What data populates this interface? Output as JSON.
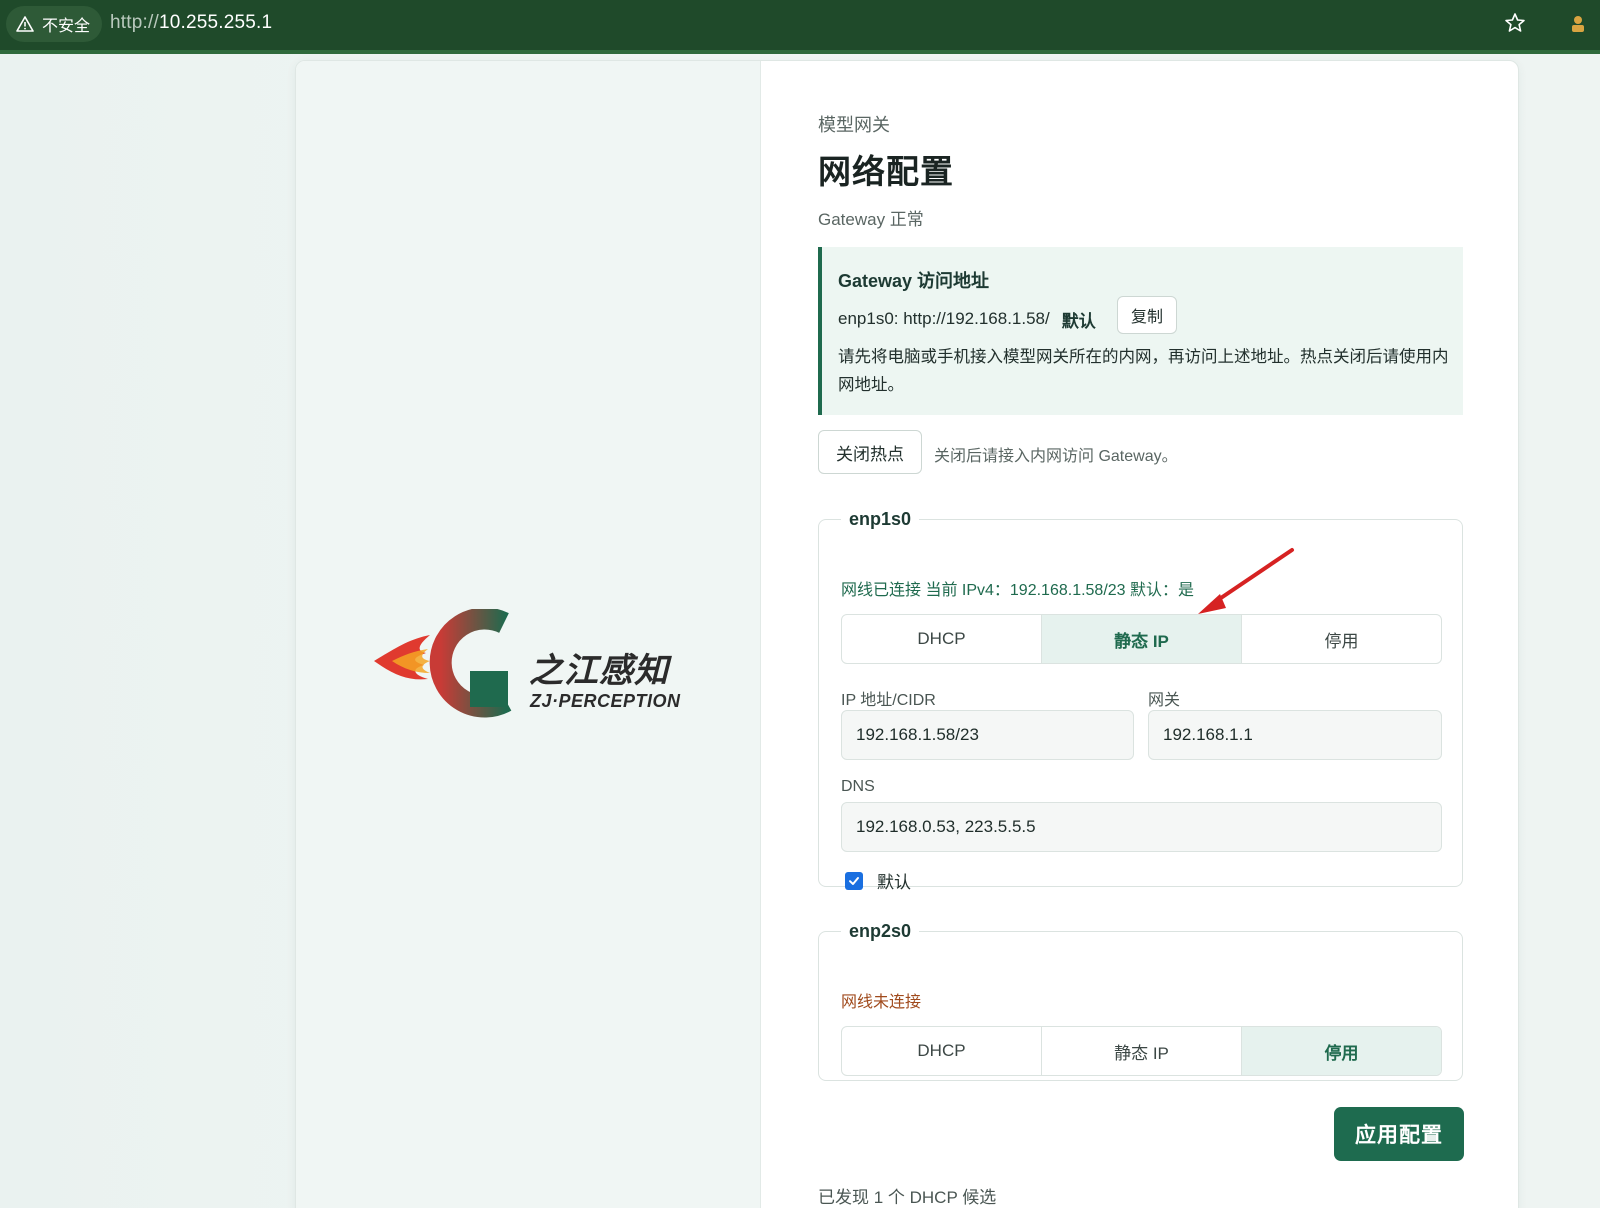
{
  "browser": {
    "security_label": "不安全",
    "url_scheme": "http://",
    "url_host": "10.255.255.1"
  },
  "brand": {
    "name_cn": "之江感知",
    "name_en": "ZJ·PERCEPTION"
  },
  "header": {
    "kicker": "模型网关",
    "title": "网络配置",
    "status": "Gateway 正常"
  },
  "access": {
    "title": "Gateway 访问地址",
    "address": "enp1s0: http://192.168.1.58/",
    "default_label": "默认",
    "copy_label": "复制",
    "note": "请先将电脑或手机接入模型网关所在的内网，再访问上述地址。热点关闭后请使用内网地址。"
  },
  "hotspot": {
    "button_label": "关闭热点",
    "note": "关闭后请接入内网访问 Gateway。"
  },
  "interfaces": [
    {
      "name": "enp1s0",
      "status": "网线已连接 当前 IPv4：192.168.1.58/23 默认：是",
      "status_color": "#1f6a4e",
      "modes": [
        "DHCP",
        "静态 IP",
        "停用"
      ],
      "active_mode": "静态 IP",
      "ip_label": "IP 地址/CIDR",
      "ip_value": "192.168.1.58/23",
      "gateway_label": "网关",
      "gateway_value": "192.168.1.1",
      "dns_label": "DNS",
      "dns_value": "192.168.0.53, 223.5.5.5",
      "default_checked": true,
      "default_label": "默认"
    },
    {
      "name": "enp2s0",
      "status": "网线未连接",
      "status_color": "#a04a1c",
      "modes": [
        "DHCP",
        "静态 IP",
        "停用"
      ],
      "active_mode": "停用"
    }
  ],
  "actions": {
    "apply_label": "应用配置"
  },
  "footer": {
    "dhcp_found": "已发现 1 个 DHCP 候选"
  },
  "colors": {
    "accent": "#1e6b4f",
    "browser_bar": "#1f4a2a",
    "annotation_arrow": "#d62222"
  }
}
